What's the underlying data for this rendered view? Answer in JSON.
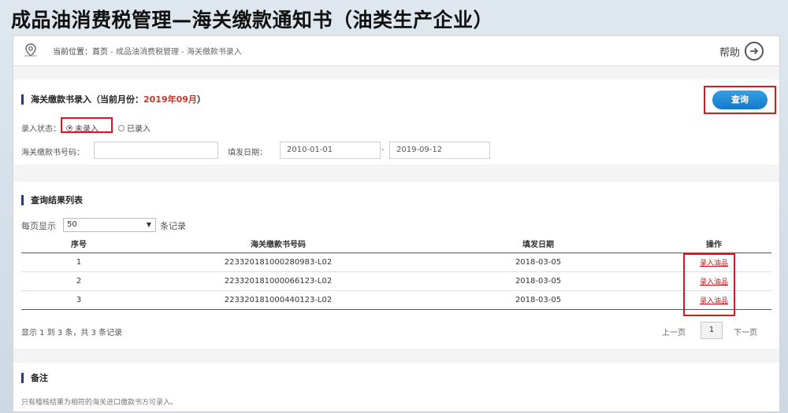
{
  "slide_title": "成品油消费税管理—海关缴款通知书（油类生产企业）",
  "breadcrumb": {
    "label": "当前位置：",
    "home": "首页",
    "path": " - 成品油消费税管理 - 海关缴款书录入"
  },
  "help": {
    "label": "帮助"
  },
  "entry": {
    "title": "海关缴款书录入（当前月份：",
    "month": "2019年09月",
    "title_end": "）",
    "query_button": "查询",
    "status_label": "录入状态：",
    "status_options": [
      "未录入",
      "已录入"
    ],
    "status_selected": "未录入",
    "number_label": "海关缴款书号码：",
    "number_value": "",
    "date_label": "填发日期：",
    "date_from": "2010-01-01",
    "date_sep": "-",
    "date_to": "2019-09-12"
  },
  "results": {
    "title": "查询结果列表",
    "per_page_prefix": "每页显示",
    "per_page_value": "50",
    "per_page_suffix": "条记录",
    "columns": [
      "序号",
      "海关缴款书号码",
      "填发日期",
      "操作"
    ],
    "rows": [
      {
        "index": "1",
        "number": "223320181000280983-L02",
        "date": "2018-03-05",
        "action": "录入油品"
      },
      {
        "index": "2",
        "number": "223320181000066123-L02",
        "date": "2018-03-05",
        "action": "录入油品"
      },
      {
        "index": "3",
        "number": "223320181000440123-L02",
        "date": "2018-03-05",
        "action": "录入油品"
      }
    ],
    "summary": "显示 1 到 3 条，共 3 条记录",
    "prev": "上一页",
    "current_page": "1",
    "next": "下一页"
  },
  "remarks": {
    "title": "备注",
    "text": "只有稽核结果为相符的海关进口缴款书方可录入。"
  },
  "colors": {
    "accent": "#1a3d8f",
    "button": "#1478c8",
    "highlight": "#e0161b",
    "month": "#c0392b"
  }
}
